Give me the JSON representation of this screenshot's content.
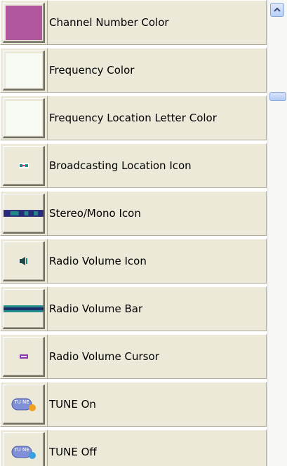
{
  "items": [
    {
      "label": "Channel Number Color",
      "icon": "magenta-swatch",
      "color": "#b0579d"
    },
    {
      "label": "Frequency Color",
      "icon": "white-swatch",
      "color": "#f7fbf3"
    },
    {
      "label": "Frequency Location Letter Color",
      "icon": "white-swatch",
      "color": "#f7fbf3"
    },
    {
      "label": "Broadcasting Location Icon",
      "icon": "broadcast-location-icon"
    },
    {
      "label": "Stereo/Mono Icon",
      "icon": "stereo-mono-icon"
    },
    {
      "label": "Radio Volume Icon",
      "icon": "speaker-icon"
    },
    {
      "label": "Radio Volume Bar",
      "icon": "volume-bar-icon"
    },
    {
      "label": "Radio Volume Cursor",
      "icon": "volume-cursor-icon"
    },
    {
      "label": "TUNE On",
      "icon": "tune-on-icon",
      "badge_text": "TU NE"
    },
    {
      "label": "TUNE Off",
      "icon": "tune-off-icon",
      "badge_text": "TU NE"
    }
  ],
  "scrollbar": {
    "up_arrow": "chevron-up-icon"
  },
  "colors": {
    "panel": "#ece9d8",
    "teal": "#1f8a8a",
    "navy": "#2a2a7a",
    "purple": "#8a3aa8",
    "orange": "#f0a020",
    "pill_blue": "#7f8fd8"
  }
}
